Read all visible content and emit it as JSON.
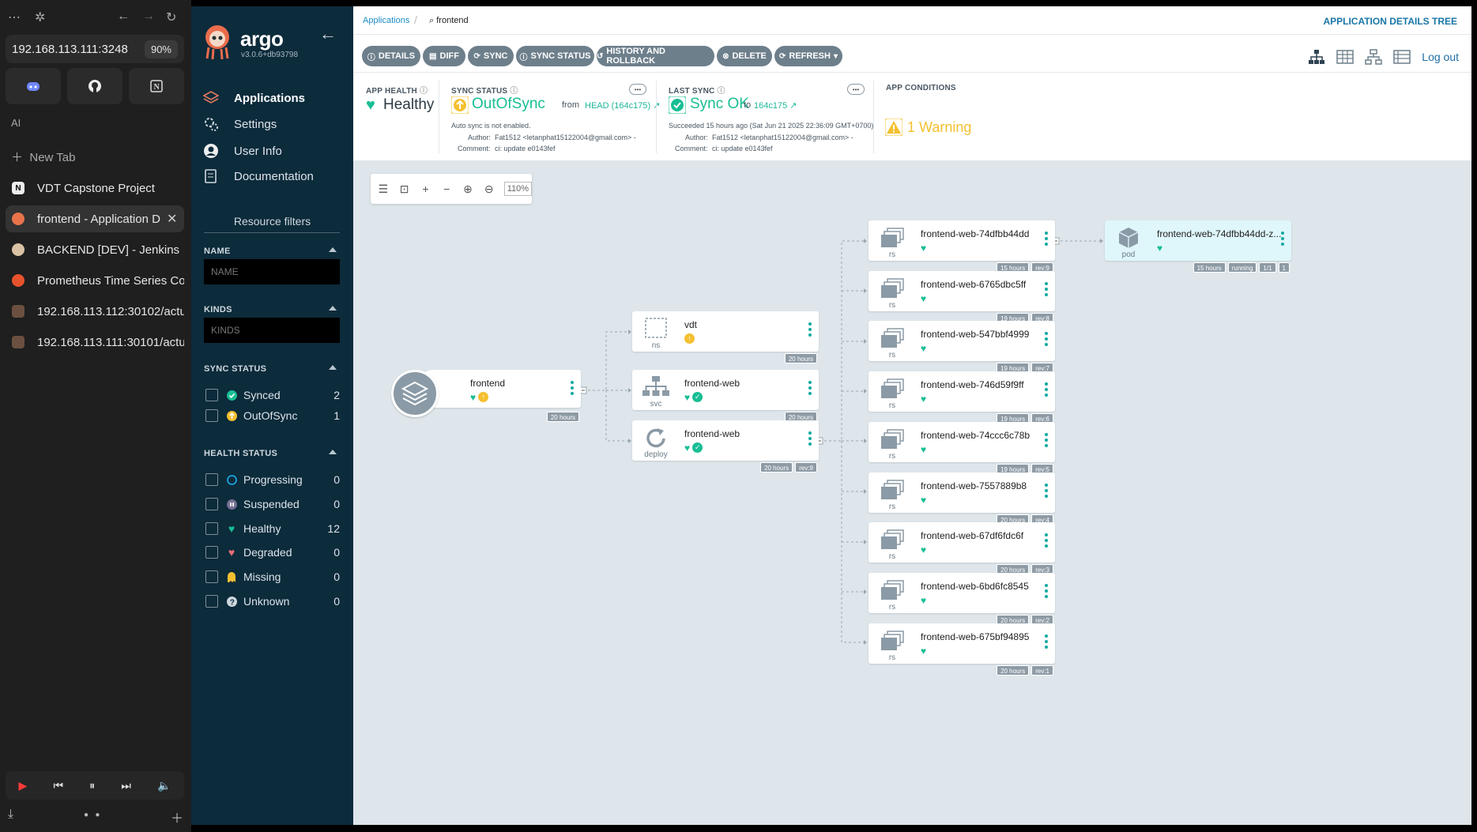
{
  "browser": {
    "address": "192.168.113.111:3248",
    "zoom": "90%",
    "section_label": "AI",
    "new_tab_label": "New Tab",
    "tabs": [
      {
        "title": "VDT Capstone Project",
        "icon": "notion-icon"
      },
      {
        "title": "frontend - Application D",
        "icon": "argo-icon",
        "active": true
      },
      {
        "title": "BACKEND [DEV] - Jenkins",
        "icon": "jenkins-icon"
      },
      {
        "title": "Prometheus Time Series Col",
        "icon": "prometheus-icon"
      },
      {
        "title": "192.168.113.112:30102/actu",
        "icon": "page-icon"
      },
      {
        "title": "192.168.113.111:30101/actu",
        "icon": "page-icon"
      }
    ]
  },
  "app": {
    "brand": "argo",
    "version": "v3.0.6+db93798",
    "nav": [
      {
        "label": "Applications",
        "icon": "layers-icon",
        "active": true
      },
      {
        "label": "Settings",
        "icon": "gears-icon"
      },
      {
        "label": "User Info",
        "icon": "user-icon"
      },
      {
        "label": "Documentation",
        "icon": "book-icon"
      }
    ],
    "filters": {
      "title": "Resource filters",
      "name_label": "NAME",
      "name_placeholder": "NAME",
      "kinds_label": "KINDS",
      "kinds_placeholder": "KINDS",
      "sync_label": "SYNC STATUS",
      "sync_items": [
        {
          "label": "Synced",
          "count": "2"
        },
        {
          "label": "OutOfSync",
          "count": "1"
        }
      ],
      "health_label": "HEALTH STATUS",
      "health_items": [
        {
          "label": "Progressing",
          "count": "0"
        },
        {
          "label": "Suspended",
          "count": "0"
        },
        {
          "label": "Healthy",
          "count": "12"
        },
        {
          "label": "Degraded",
          "count": "0"
        },
        {
          "label": "Missing",
          "count": "0"
        },
        {
          "label": "Unknown",
          "count": "0"
        }
      ]
    }
  },
  "topbar": {
    "breadcrumb_root": "Applications",
    "breadcrumb_current": "frontend",
    "view_title": "APPLICATION DETAILS TREE"
  },
  "toolbar": {
    "buttons": [
      "DETAILS",
      "DIFF",
      "SYNC",
      "SYNC STATUS",
      "HISTORY AND ROLLBACK",
      "DELETE",
      "REFRESH"
    ],
    "logout": "Log out"
  },
  "summary": {
    "health_label": "APP HEALTH",
    "health_value": "Healthy",
    "sync_label": "SYNC STATUS",
    "sync_value": "OutOfSync",
    "sync_from": "from",
    "sync_ref": "HEAD (164c175)",
    "auto_sync": "Auto sync is not enabled.",
    "author_label": "Author:",
    "author": "Fat1512 <letanphat15122004@gmail.com> -",
    "comment_label": "Comment:",
    "comment": "ci: update e0143fef",
    "last_sync_label": "LAST SYNC",
    "last_sync_value": "Sync OK",
    "last_sync_to": "to",
    "last_sync_rev": "164c175",
    "last_sync_time": "Succeeded 15 hours ago (Sat Jun 21 2025 22:36:09 GMT+0700)",
    "conditions_label": "APP CONDITIONS",
    "conditions_value": "1 Warning"
  },
  "graph": {
    "zoom": "110%",
    "app_node": {
      "name": "frontend",
      "age": "20 hours"
    },
    "nodes": [
      {
        "name": "vdt",
        "kind": "ns",
        "age": "20 hours"
      },
      {
        "name": "frontend-web",
        "kind": "svc",
        "age": "20 hours"
      },
      {
        "name": "frontend-web",
        "kind": "deploy",
        "age": "20 hours",
        "rev": "rev:9"
      }
    ],
    "replicasets": [
      {
        "name": "frontend-web-74dfbb44dd",
        "kind": "rs",
        "age": "15 hours",
        "rev": "rev:9"
      },
      {
        "name": "frontend-web-6765dbc5ff",
        "kind": "rs",
        "age": "19 hours",
        "rev": "rev:8"
      },
      {
        "name": "frontend-web-547bbf4999",
        "kind": "rs",
        "age": "19 hours",
        "rev": "rev:7"
      },
      {
        "name": "frontend-web-746d59f9ff",
        "kind": "rs",
        "age": "19 hours",
        "rev": "rev:6"
      },
      {
        "name": "frontend-web-74ccc6c78b",
        "kind": "rs",
        "age": "19 hours",
        "rev": "rev:5"
      },
      {
        "name": "frontend-web-7557889b8",
        "kind": "rs",
        "age": "20 hours",
        "rev": "rev:4"
      },
      {
        "name": "frontend-web-67df6fdc6f",
        "kind": "rs",
        "age": "20 hours",
        "rev": "rev:3"
      },
      {
        "name": "frontend-web-6bd6fc8545",
        "kind": "rs",
        "age": "20 hours",
        "rev": "rev:2"
      },
      {
        "name": "frontend-web-675bf94895",
        "kind": "rs",
        "age": "20 hours",
        "rev": "rev:1"
      }
    ],
    "pod": {
      "name": "frontend-web-74dfbb44dd-z...",
      "kind": "pod",
      "age": "15 hours",
      "status": "running",
      "ready": "1/1",
      "restarts": "1"
    }
  },
  "colors": {
    "healthy": "#18be94",
    "warning": "#f4c030",
    "accent": "#1b8cc4",
    "nav_bg": "#0c2b3b"
  }
}
